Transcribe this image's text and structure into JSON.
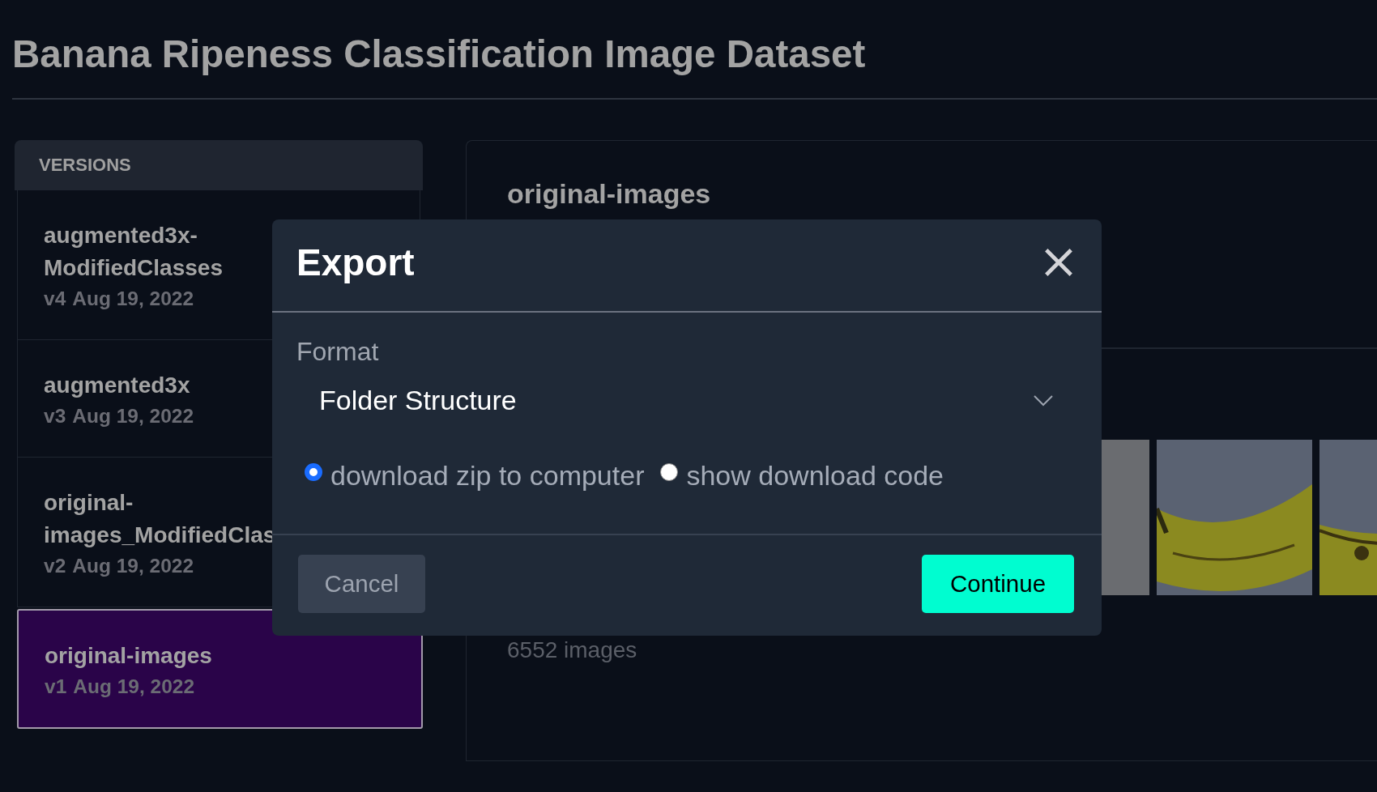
{
  "page": {
    "title": "Banana Ripeness Classification Image Dataset"
  },
  "sidebar": {
    "header": "VERSIONS",
    "items": [
      {
        "name": "augmented3x-ModifiedClasses",
        "version": "v4",
        "date": "Aug 19, 2022",
        "selected": false
      },
      {
        "name": "augmented3x",
        "version": "v3",
        "date": "Aug 19, 2022",
        "selected": false
      },
      {
        "name": "original-images_ModifiedClas",
        "version": "v2",
        "date": "Aug 19, 2022",
        "selected": false
      },
      {
        "name": "original-images",
        "version": "v1",
        "date": "Aug 19, 2022",
        "selected": true
      }
    ]
  },
  "panel": {
    "title": "original-images",
    "image_count": "6552 images"
  },
  "dialog": {
    "title": "Export",
    "format_label": "Format",
    "format_value": "Folder Structure",
    "options": [
      {
        "label": "download zip to computer",
        "selected": true
      },
      {
        "label": "show download code",
        "selected": false
      }
    ],
    "buttons": [
      {
        "label": "Cancel",
        "kind": "secondary"
      },
      {
        "label": "Continue",
        "kind": "primary"
      }
    ]
  }
}
